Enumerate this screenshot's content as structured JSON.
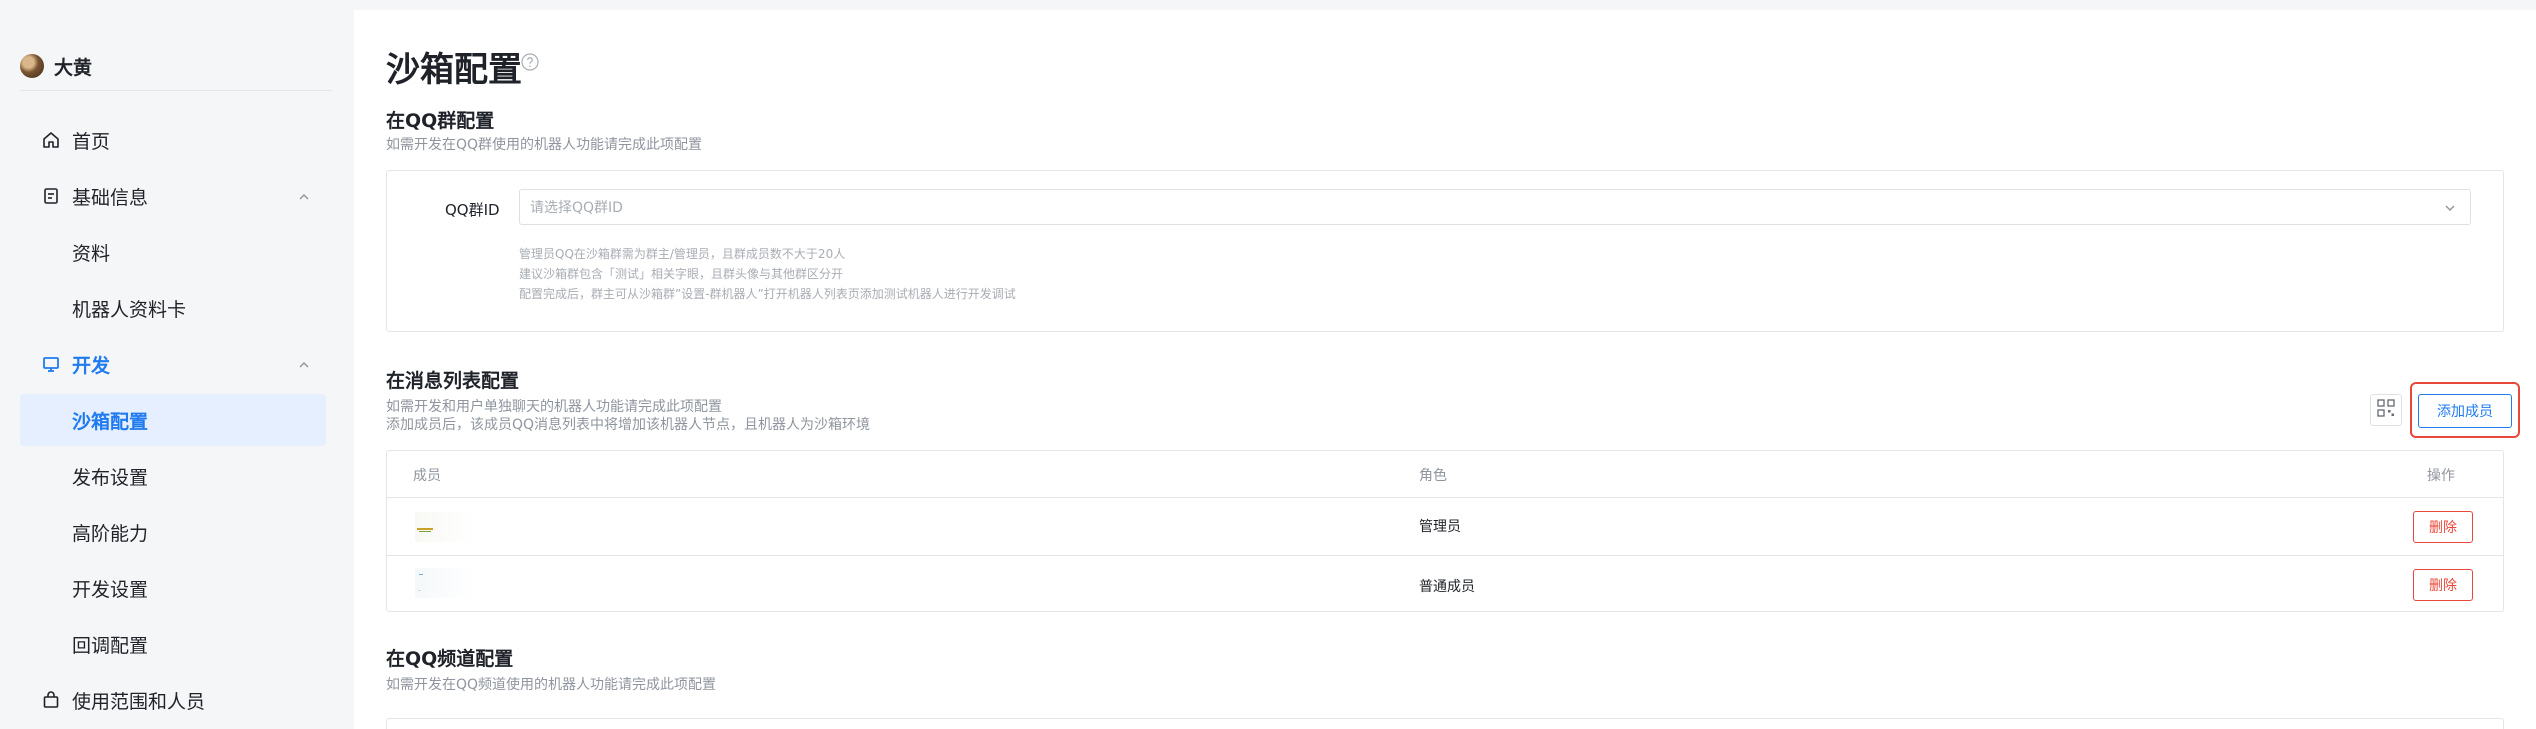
{
  "sidebar": {
    "user_name": "大黄",
    "items": [
      {
        "label": "首页"
      },
      {
        "label": "基础信息"
      },
      {
        "label": "资料"
      },
      {
        "label": "机器人资料卡"
      },
      {
        "label": "开发"
      },
      {
        "label": "沙箱配置"
      },
      {
        "label": "发布设置"
      },
      {
        "label": "高阶能力"
      },
      {
        "label": "开发设置"
      },
      {
        "label": "回调配置"
      },
      {
        "label": "使用范围和人员"
      }
    ]
  },
  "main": {
    "title": "沙箱配置",
    "qq_group": {
      "title": "在QQ群配置",
      "desc": "如需开发在QQ群使用的机器人功能请完成此项配置",
      "field_label": "QQ群ID",
      "placeholder": "请选择QQ群ID",
      "hints": [
        "管理员QQ在沙箱群需为群主/管理员，且群成员数不大于20人",
        "建议沙箱群包含「测试」相关字眼，且群头像与其他群区分开",
        "配置完成后，群主可从沙箱群”设置-群机器人”打开机器人列表页添加测试机器人进行开发调试"
      ]
    },
    "message_list": {
      "title": "在消息列表配置",
      "desc1": "如需开发和用户单独聊天的机器人功能请完成此项配置",
      "desc2": "添加成员后，该成员QQ消息列表中将增加该机器人节点，且机器人为沙箱环境",
      "add_button": "添加成员",
      "columns": [
        "成员",
        "角色",
        "操作"
      ],
      "rows": [
        {
          "role": "管理员",
          "action": "删除"
        },
        {
          "role": "普通成员",
          "action": "删除"
        }
      ]
    },
    "qq_channel": {
      "title": "在QQ频道配置",
      "desc": "如需开发在QQ频道使用的机器人功能请完成此项配置"
    }
  },
  "colors": {
    "accent": "#1f7bef",
    "danger": "#e8483a",
    "active_bg": "#e5efff"
  }
}
